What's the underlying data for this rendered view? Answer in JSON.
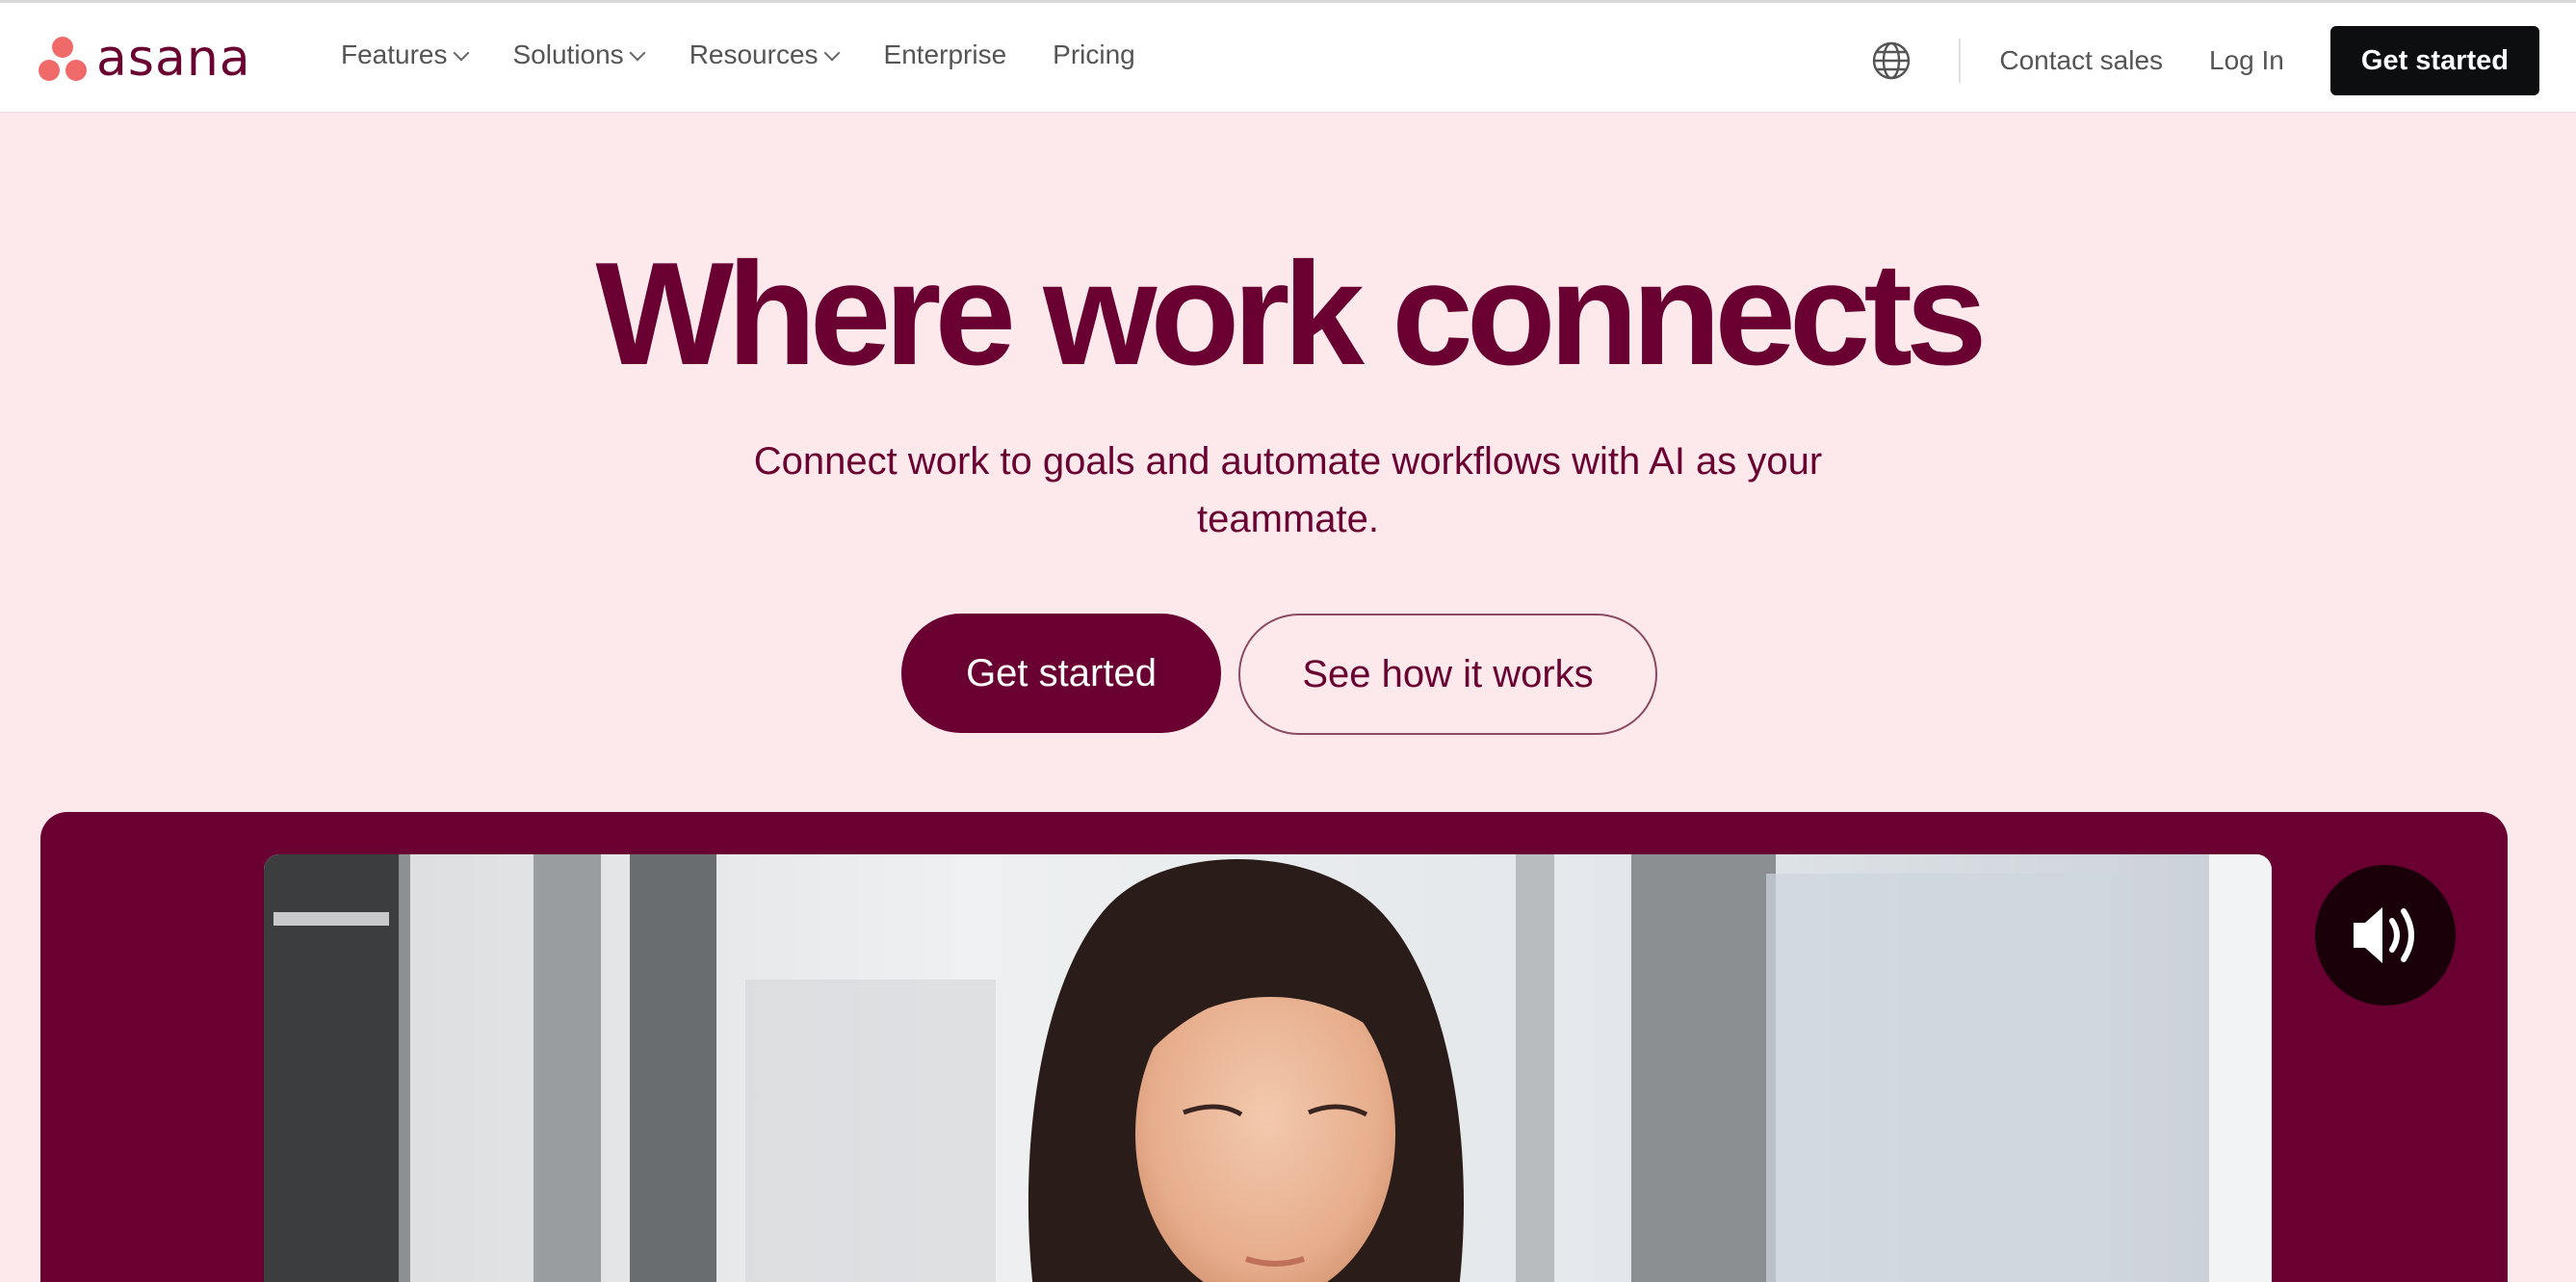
{
  "header": {
    "logo_text": "asana",
    "nav": [
      {
        "label": "Features",
        "has_dropdown": true
      },
      {
        "label": "Solutions",
        "has_dropdown": true
      },
      {
        "label": "Resources",
        "has_dropdown": true
      },
      {
        "label": "Enterprise",
        "has_dropdown": false
      },
      {
        "label": "Pricing",
        "has_dropdown": false
      }
    ],
    "language_icon": "globe-icon",
    "contact_sales": "Contact sales",
    "log_in": "Log In",
    "get_started": "Get started"
  },
  "hero": {
    "title": "Where work connects",
    "subtitle": "Connect work to goals and automate workflows with AI as your teammate.",
    "primary_cta": "Get started",
    "secondary_cta": "See how it works"
  },
  "video": {
    "sound_icon": "speaker-volume-icon"
  },
  "colors": {
    "brand": "#690031",
    "logo_coral": "#f06a6a",
    "hero_background": "#fde8ec",
    "header_cta": "#0d0e10"
  }
}
